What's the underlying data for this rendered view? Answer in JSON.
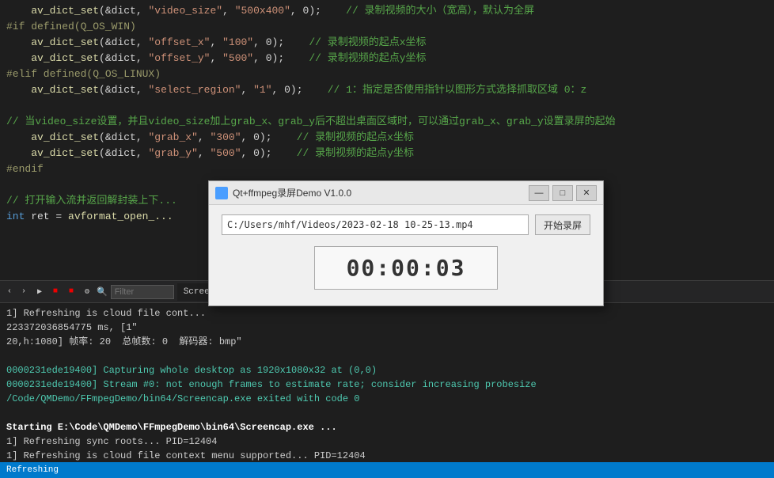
{
  "editor": {
    "background": "#1e1e1e",
    "lines": [
      {
        "indent": "    ",
        "tokens": [
          {
            "type": "fn",
            "text": "av_dict_set"
          },
          {
            "type": "plain",
            "text": "(&dict, "
          },
          {
            "type": "str",
            "text": "\"video_size\""
          },
          {
            "type": "plain",
            "text": ", "
          },
          {
            "type": "str",
            "text": "\"500x400\""
          },
          {
            "type": "plain",
            "text": ", 0);"
          },
          {
            "type": "comment",
            "text": "        // 录制视频的大小（宽高），默认为全屏"
          }
        ]
      },
      {
        "indent": "",
        "tokens": [
          {
            "type": "macro",
            "text": "#if defined(Q_OS_WIN)"
          }
        ]
      },
      {
        "indent": "    ",
        "tokens": [
          {
            "type": "fn",
            "text": "av_dict_set"
          },
          {
            "type": "plain",
            "text": "(&dict, "
          },
          {
            "type": "str",
            "text": "\"offset_x\""
          },
          {
            "type": "plain",
            "text": ", "
          },
          {
            "type": "str",
            "text": "\"100\""
          },
          {
            "type": "plain",
            "text": ", 0);"
          },
          {
            "type": "comment",
            "text": "        // 录制视频的起点x坐标"
          }
        ]
      },
      {
        "indent": "    ",
        "tokens": [
          {
            "type": "fn",
            "text": "av_dict_set"
          },
          {
            "type": "plain",
            "text": "(&dict, "
          },
          {
            "type": "str",
            "text": "\"offset_y\""
          },
          {
            "type": "plain",
            "text": ", "
          },
          {
            "type": "str",
            "text": "\"500\""
          },
          {
            "type": "plain",
            "text": ", 0);"
          },
          {
            "type": "comment",
            "text": "        // 录制视频的起点y坐标"
          }
        ]
      },
      {
        "indent": "",
        "tokens": [
          {
            "type": "macro",
            "text": "#elif defined(Q_OS_LINUX)"
          }
        ]
      },
      {
        "indent": "    ",
        "tokens": [
          {
            "type": "fn",
            "text": "av_dict_set"
          },
          {
            "type": "plain",
            "text": "(&dict, "
          },
          {
            "type": "str",
            "text": "\"select_region\""
          },
          {
            "type": "plain",
            "text": ", "
          },
          {
            "type": "str",
            "text": "\"1\""
          },
          {
            "type": "plain",
            "text": ", 0);"
          },
          {
            "type": "comment",
            "text": "        // 1：指定是否使用指针以图形方式选择抓取区域 0：z"
          }
        ]
      },
      {
        "indent": "",
        "tokens": []
      },
      {
        "indent": "",
        "tokens": [
          {
            "type": "comment",
            "text": "// 当video_size设置，并且video_size加上grab_x、grab_y后不超出桌面区域时，可以通过grab_x、grab_y设置录屏的起始"
          }
        ]
      },
      {
        "indent": "    ",
        "tokens": [
          {
            "type": "fn",
            "text": "av_dict_set"
          },
          {
            "type": "plain",
            "text": "(&dict, "
          },
          {
            "type": "str",
            "text": "\"grab_x\""
          },
          {
            "type": "plain",
            "text": ", "
          },
          {
            "type": "str",
            "text": "\"300\""
          },
          {
            "type": "plain",
            "text": ", 0);"
          },
          {
            "type": "comment",
            "text": "        // 录制视频的起点x坐标"
          }
        ]
      },
      {
        "indent": "    ",
        "tokens": [
          {
            "type": "fn",
            "text": "av_dict_set"
          },
          {
            "type": "plain",
            "text": "(&dict, "
          },
          {
            "type": "str",
            "text": "\"grab_y\""
          },
          {
            "type": "plain",
            "text": ", "
          },
          {
            "type": "str",
            "text": "\"500\""
          },
          {
            "type": "plain",
            "text": ", 0);"
          },
          {
            "type": "comment",
            "text": "        // 录制视频的起点y坐标"
          }
        ]
      },
      {
        "indent": "",
        "tokens": [
          {
            "type": "macro",
            "text": "#endif"
          }
        ]
      },
      {
        "indent": "",
        "tokens": []
      },
      {
        "indent": "",
        "tokens": [
          {
            "type": "comment",
            "text": "// 打开输入流并返回解封装上下..."
          }
        ]
      },
      {
        "indent": "",
        "tokens": [
          {
            "type": "kw",
            "text": "int"
          },
          {
            "type": "plain",
            "text": " ret = "
          },
          {
            "type": "fn",
            "text": "avformat_open_..."
          }
        ]
      }
    ]
  },
  "bottom_panel": {
    "tabs": [
      {
        "label": "Screencap",
        "has_close": true
      }
    ],
    "filter_placeholder": "Filter",
    "output_lines": [
      {
        "style": "out-normal",
        "text": "1] Refreshing is cloud file cont..."
      },
      {
        "style": "out-normal",
        "text": "223372036854775 ms, [1\""
      },
      {
        "style": "out-normal",
        "text": "20,h:1080] 帧率: 20  总帧数: 0  解码器: bmp\""
      },
      {
        "style": "out-normal",
        "text": ""
      },
      {
        "style": "out-teal",
        "text": "0000231ede19400] Capturing whole desktop as 1920x1080x32 at (0,0)"
      },
      {
        "style": "out-teal",
        "text": "0000231ede19400] Stream #0: not enough frames to estimate rate; consider increasing probesize"
      },
      {
        "style": "out-teal",
        "text": "/Code/QMDemo/FFmpegDemo/bin64/Screencap.exe exited with code 0"
      },
      {
        "style": "out-normal",
        "text": ""
      },
      {
        "style": "out-bold-bright",
        "text": "Starting E:\\Code\\QMDemo\\FFmpegDemo\\bin64\\Screencap.exe ..."
      },
      {
        "style": "out-normal",
        "text": "1] Refreshing sync roots... PID=12404"
      },
      {
        "style": "out-normal",
        "text": "1] Refreshing is cloud file context menu supported... PID=12404"
      }
    ]
  },
  "dialog": {
    "title": "Qt+ffmpeg录屏Demo V1.0.0",
    "file_path": "C:/Users/mhf/Videos/2023-02-18 10-25-13.mp4",
    "record_btn_label": "开始录屏",
    "timer": "00:00:03",
    "min_btn": "—",
    "max_btn": "□",
    "close_btn": "✕"
  },
  "status_bar": {
    "text": "Refreshing"
  }
}
